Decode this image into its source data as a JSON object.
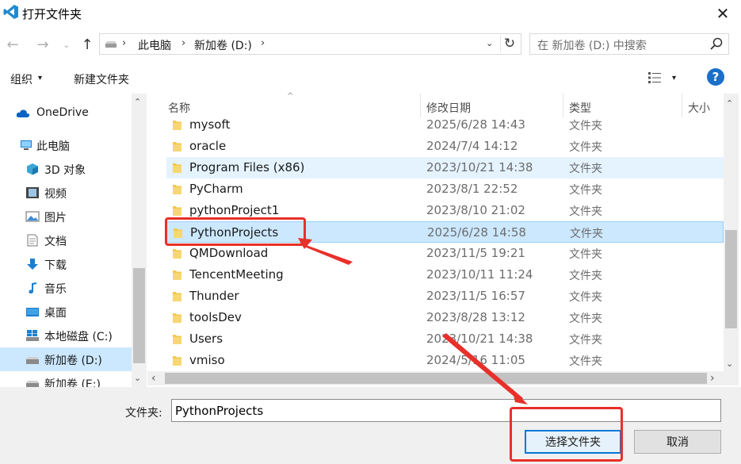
{
  "window": {
    "title": "打开文件夹",
    "close_glyph": "✕"
  },
  "nav": {
    "back": "←",
    "forward": "→",
    "history": "⌄",
    "up": "↑"
  },
  "address": {
    "sep": "›",
    "crumbs": [
      "此电脑",
      "新加卷 (D:)"
    ],
    "dropdown": "⌄",
    "refresh": "↻"
  },
  "search": {
    "placeholder": "在 新加卷 (D:) 中搜索"
  },
  "toolbar": {
    "organize": "组织",
    "organize_arrow": "▾",
    "new_folder": "新建文件夹",
    "view_arrow": "▾",
    "help": "?"
  },
  "sidebar": {
    "items": [
      {
        "label": "OneDrive",
        "icon": "cloud-icon"
      },
      {
        "label": "此电脑",
        "icon": "computer-icon"
      },
      {
        "label": "3D 对象",
        "icon": "cube-icon"
      },
      {
        "label": "视频",
        "icon": "film-icon"
      },
      {
        "label": "图片",
        "icon": "picture-icon"
      },
      {
        "label": "文档",
        "icon": "document-icon"
      },
      {
        "label": "下载",
        "icon": "download-icon"
      },
      {
        "label": "音乐",
        "icon": "music-icon"
      },
      {
        "label": "桌面",
        "icon": "desktop-icon"
      },
      {
        "label": "本地磁盘 (C:)",
        "icon": "windows-drive-icon"
      },
      {
        "label": "新加卷 (D:)",
        "icon": "drive-icon"
      },
      {
        "label": "新加卷 (E:)",
        "icon": "drive-icon"
      }
    ],
    "selected_index": 10
  },
  "columns": {
    "name": "名称",
    "modified": "修改日期",
    "type": "类型",
    "size": "大小",
    "sort_glyph": "^"
  },
  "files": [
    {
      "name": "mysoft",
      "modified": "2025/6/28 14:43",
      "type": "文件夹"
    },
    {
      "name": "oracle",
      "modified": "2024/7/4 14:12",
      "type": "文件夹"
    },
    {
      "name": "Program Files (x86)",
      "modified": "2023/10/21 14:38",
      "type": "文件夹"
    },
    {
      "name": "PyCharm",
      "modified": "2023/8/1 22:52",
      "type": "文件夹"
    },
    {
      "name": "pythonProject1",
      "modified": "2023/8/10 21:02",
      "type": "文件夹"
    },
    {
      "name": "PythonProjects",
      "modified": "2025/6/28 14:58",
      "type": "文件夹"
    },
    {
      "name": "QMDownload",
      "modified": "2023/11/5 19:21",
      "type": "文件夹"
    },
    {
      "name": "TencentMeeting",
      "modified": "2023/10/11 11:24",
      "type": "文件夹"
    },
    {
      "name": "Thunder",
      "modified": "2023/11/5 16:57",
      "type": "文件夹"
    },
    {
      "name": "toolsDev",
      "modified": "2023/8/28 13:12",
      "type": "文件夹"
    },
    {
      "name": "Users",
      "modified": "2023/10/21 14:38",
      "type": "文件夹"
    },
    {
      "name": "vmiso",
      "modified": "2024/5/16 11:05",
      "type": "文件夹"
    }
  ],
  "hover_index": 2,
  "selected_file_index": 5,
  "scroll": {
    "up": "⌃",
    "down": "⌄",
    "left": "‹",
    "right": "›"
  },
  "footer": {
    "folder_label": "文件夹:",
    "folder_value": "PythonProjects",
    "select_button": "选择文件夹",
    "cancel_button": "取消"
  },
  "colors": {
    "annotation": "#e8302a",
    "folder": "#f2c94c",
    "accent": "#0078d7"
  }
}
